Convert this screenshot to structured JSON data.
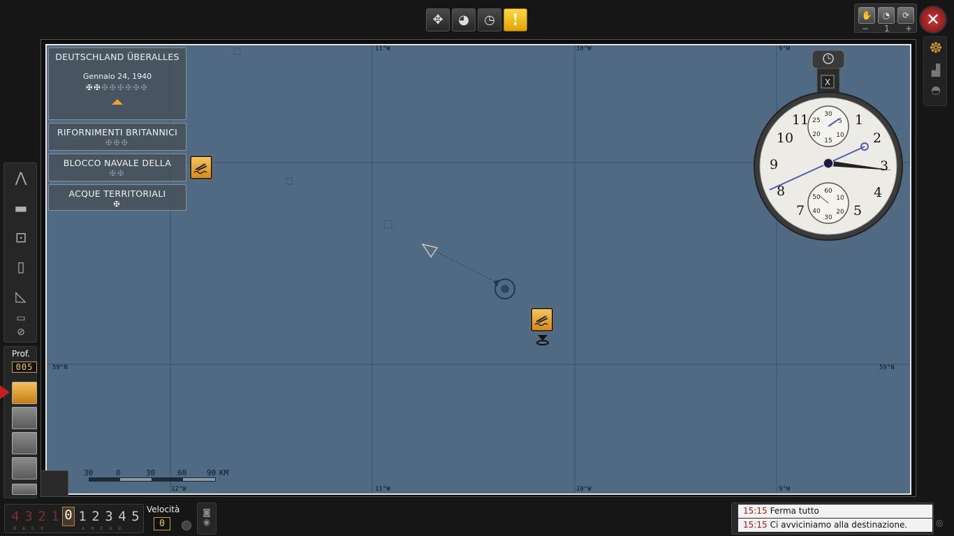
{
  "toolbar": {
    "buttons": [
      {
        "name": "move",
        "icon": "move-arrows-icon",
        "glyph": "✥"
      },
      {
        "name": "globe",
        "icon": "globe-icon",
        "glyph": "◕"
      },
      {
        "name": "clock",
        "icon": "clock-icon",
        "glyph": "◷"
      },
      {
        "name": "alert",
        "icon": "alert-icon",
        "glyph": "!"
      }
    ]
  },
  "time_compression": {
    "minus": "−",
    "value": "1",
    "plus": "+"
  },
  "close_glyph": "✕",
  "map": {
    "longitude_labels_top": [
      "11°W",
      "10°W",
      "9°W"
    ],
    "longitude_labels_bottom": [
      "12°W",
      "11°W",
      "10°W",
      "9°W"
    ],
    "latitude_label": "59°N",
    "scale": {
      "labels": [
        "30",
        "0",
        "30",
        "60",
        "90"
      ],
      "unit": "KM"
    }
  },
  "missions": [
    {
      "title": "DEUTSCHLAND ÜBERALLES",
      "date": "Gennaio 24, 1940",
      "crosses_on": 2,
      "crosses_total": 8
    },
    {
      "title": "RIFORNIMENTI BRITANNICI",
      "crosses_on": 0,
      "crosses_total": 3
    },
    {
      "title": "BLOCCO NAVALE DELLA",
      "crosses_on": 0,
      "crosses_total": 2
    },
    {
      "title": "ACQUE TERRITORIALI",
      "crosses_on": 1,
      "crosses_total": 1
    }
  ],
  "stopwatch": {
    "x_label": "X",
    "dial_numbers": [
      "1",
      "2",
      "3",
      "4",
      "5",
      "7",
      "8",
      "9",
      "10",
      "11"
    ],
    "upper_subdial": [
      "30",
      "5",
      "10",
      "15",
      "20",
      "25"
    ],
    "lower_subdial": [
      "60",
      "10",
      "20",
      "30",
      "40",
      "50"
    ]
  },
  "depth": {
    "label": "Prof.",
    "value": "005"
  },
  "telegraph": {
    "back": [
      "4",
      "3",
      "2",
      "1"
    ],
    "stop": "0",
    "ahead": [
      "1",
      "2",
      "3",
      "4",
      "5"
    ],
    "back_label": "BACK",
    "ahead_label": "AHEAD"
  },
  "speed": {
    "label": "Velocità",
    "value": "0"
  },
  "messages": [
    {
      "time": "15:15",
      "text": "Ferma tutto"
    },
    {
      "time": "15:15",
      "text": "Ci avviciniamo alla destinazione."
    }
  ],
  "colors": {
    "sea": "#4f6a82",
    "accent_orange": "#e8a025",
    "alert_yellow": "#f5c518",
    "close_red": "#b02a2a"
  }
}
